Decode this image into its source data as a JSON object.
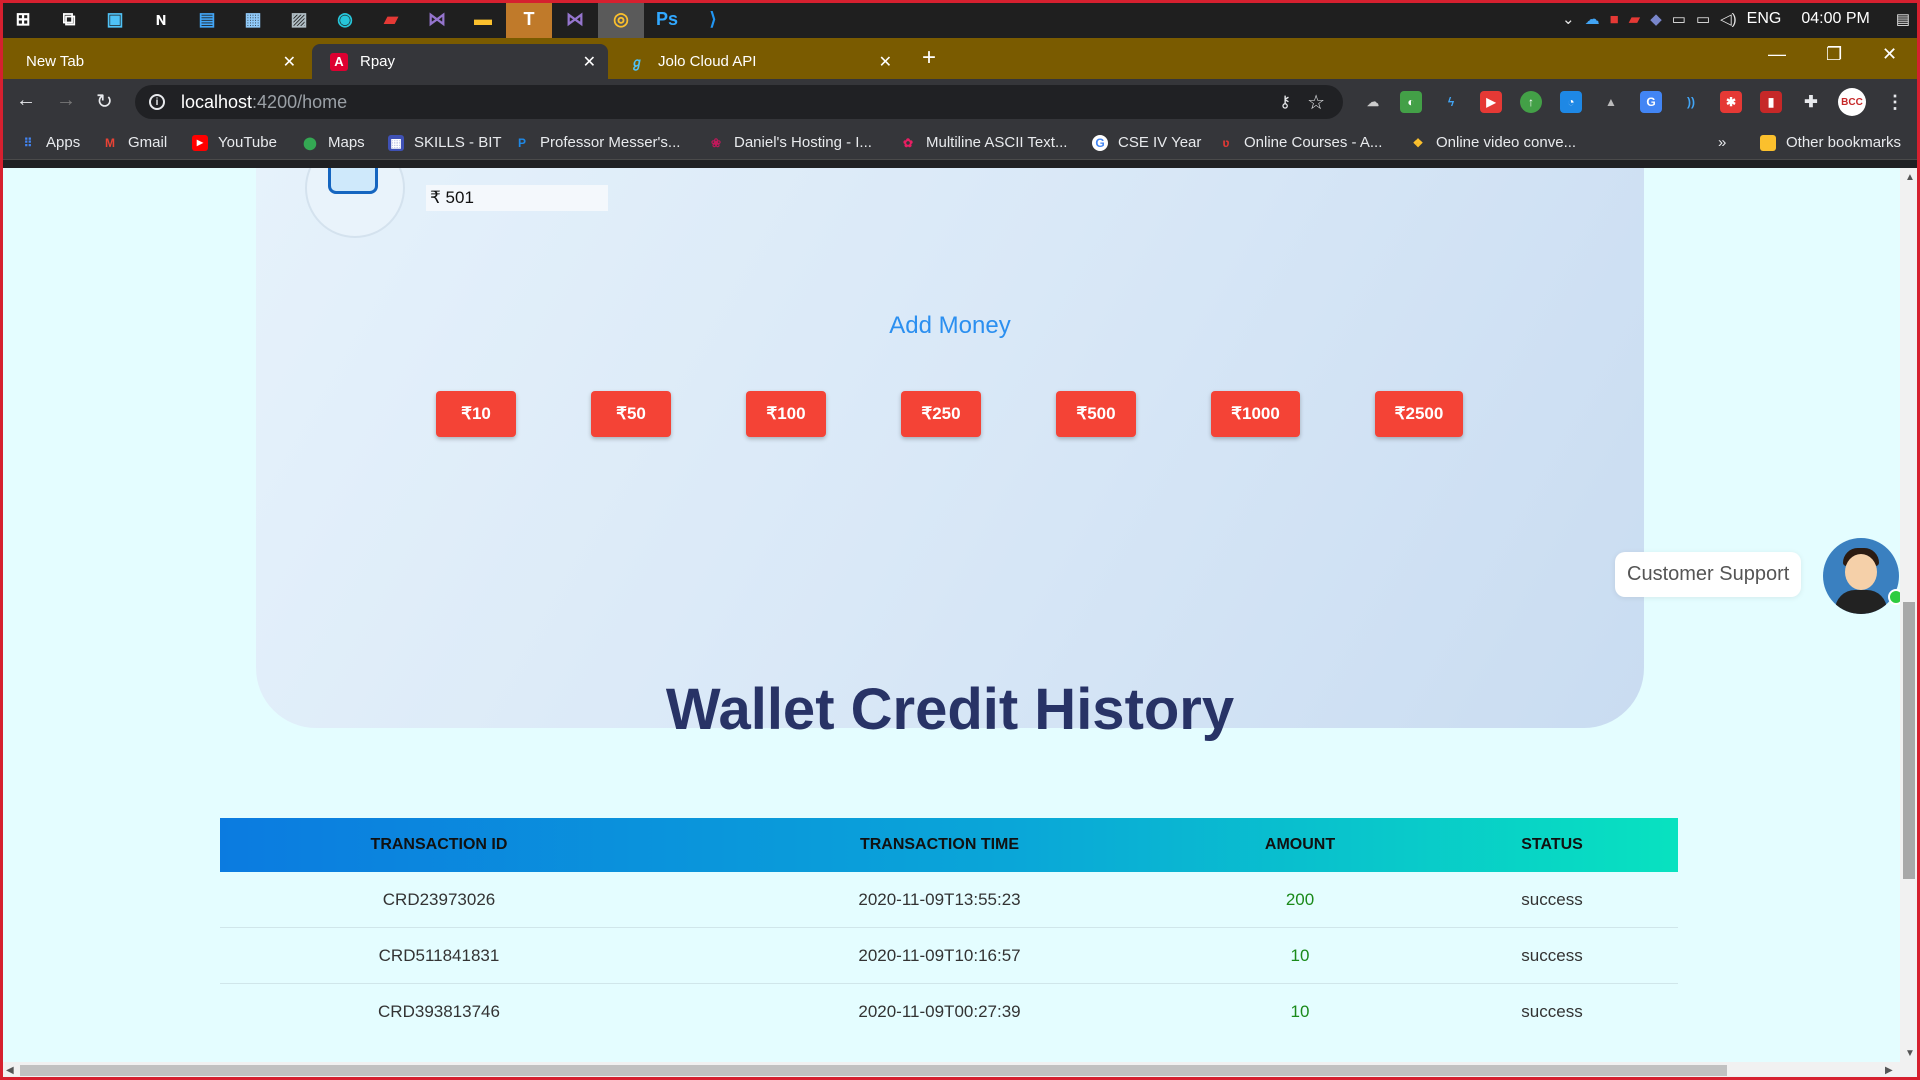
{
  "taskbar": {
    "icons": [
      "windows-icon",
      "task-view-icon",
      "app-icon",
      "app-icon",
      "app-icon",
      "app-icon",
      "photos-icon",
      "edge-icon",
      "app-icon",
      "visual-studio-icon",
      "file-explorer-icon",
      "teams-icon",
      "visual-studio-icon",
      "chrome-icon",
      "photoshop-icon",
      "vscode-icon"
    ],
    "language": "ENG",
    "time": "04:00 PM"
  },
  "tabs": [
    {
      "title": "New Tab",
      "active": false
    },
    {
      "title": "Rpay",
      "active": true
    },
    {
      "title": "Jolo Cloud API",
      "active": false
    }
  ],
  "toolbar": {
    "url_host": "localhost",
    "url_path": ":4200/home"
  },
  "bookmarks": [
    {
      "label": "Apps",
      "icon": "apps-grid-icon",
      "color": "#4285f4"
    },
    {
      "label": "Gmail",
      "icon": "gmail-icon",
      "color": "#ea4335"
    },
    {
      "label": "YouTube",
      "icon": "youtube-icon",
      "color": "#ff0000"
    },
    {
      "label": "Maps",
      "icon": "maps-icon",
      "color": "#34a853"
    },
    {
      "label": "SKILLS - BIT",
      "icon": "skills-icon",
      "color": "#3f51b5"
    },
    {
      "label": "Professor Messer's...",
      "icon": "messer-icon",
      "color": "#1e88e5"
    },
    {
      "label": "Daniel's Hosting - I...",
      "icon": "raspberry-icon",
      "color": "#c2185b"
    },
    {
      "label": "Multiline ASCII Text...",
      "icon": "ascii-icon",
      "color": "#e91e63"
    },
    {
      "label": "CSE IV Year",
      "icon": "google-icon",
      "color": "#ffffff"
    },
    {
      "label": "Online Courses - A...",
      "icon": "courses-icon",
      "color": "#e53935"
    },
    {
      "label": "Online video conve...",
      "icon": "video-icon",
      "color": "#fbc02d"
    }
  ],
  "other_bookmarks": "Other bookmarks",
  "wallet": {
    "balance": "₹ 501"
  },
  "add_money": {
    "title": "Add Money",
    "amounts": [
      "₹10",
      "₹50",
      "₹100",
      "₹250",
      "₹500",
      "₹1000",
      "₹2500"
    ]
  },
  "support": {
    "label": "Customer Support"
  },
  "history": {
    "title": "Wallet Credit History",
    "columns": [
      "TRANSACTION ID",
      "TRANSACTION TIME",
      "AMOUNT",
      "STATUS"
    ],
    "rows": [
      {
        "id": "CRD23973026",
        "time": "2020-11-09T13:55:23",
        "amount": "200",
        "status": "success"
      },
      {
        "id": "CRD511841831",
        "time": "2020-11-09T10:16:57",
        "amount": "10",
        "status": "success"
      },
      {
        "id": "CRD393813746",
        "time": "2020-11-09T00:27:39",
        "amount": "10",
        "status": "success"
      }
    ]
  },
  "colors": {
    "accent_red": "#f44336",
    "heading_navy": "#283366",
    "link_blue": "#2b8ff0",
    "amount_green": "#1a8a1a"
  }
}
